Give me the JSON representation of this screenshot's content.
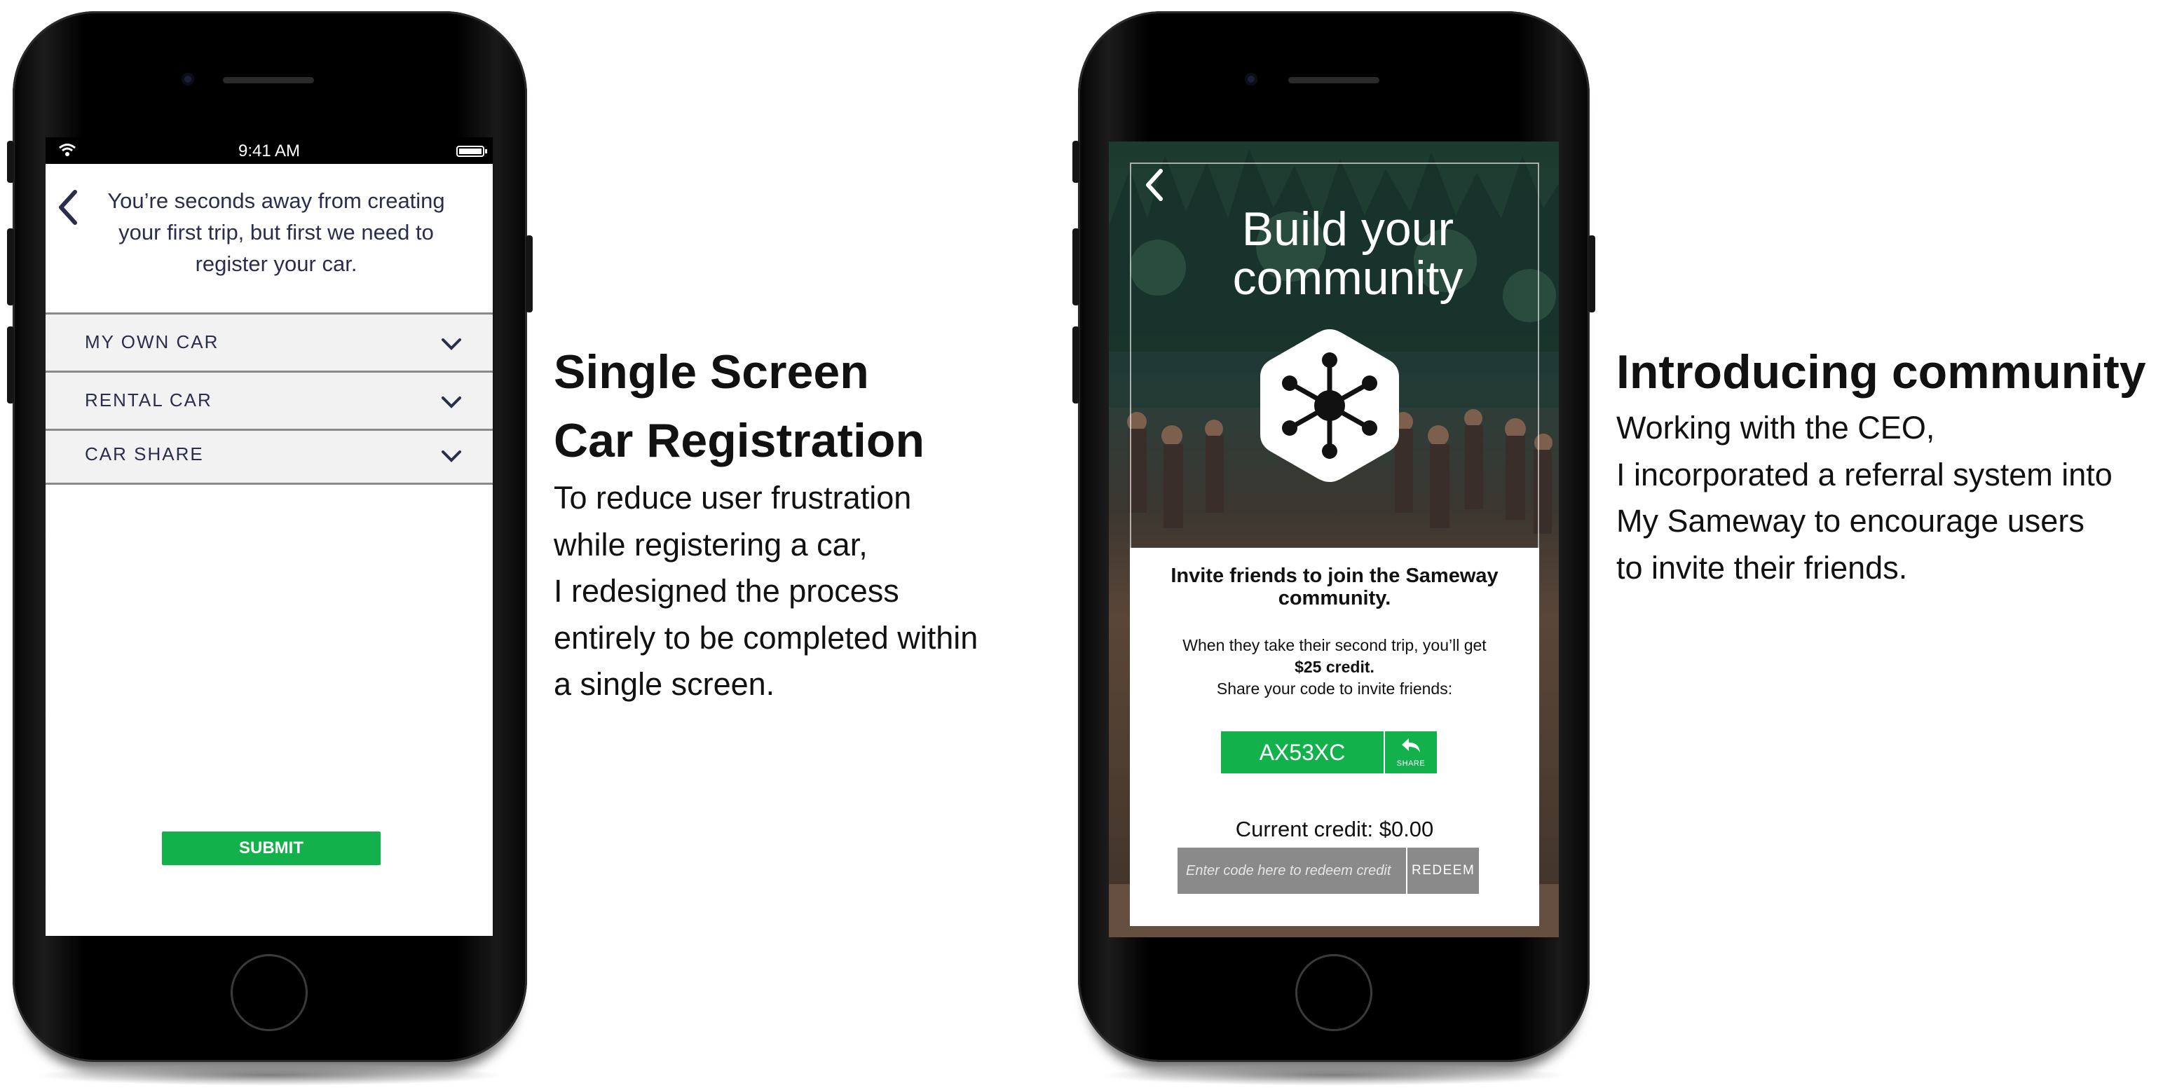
{
  "phone1": {
    "status_time": "9:41 AM",
    "header": "You’re seconds away from creating your first trip, but first we need to register your car.",
    "options": [
      {
        "label": "MY OWN CAR"
      },
      {
        "label": "RENTAL CAR"
      },
      {
        "label": "CAR SHARE"
      }
    ],
    "submit_label": "SUBMIT"
  },
  "caption1": {
    "title_lines": [
      "Single Screen",
      "Car Registration"
    ],
    "body_lines": [
      "To reduce user frustration",
      "while registering a car,",
      "I redesigned the process",
      "entirely to be completed within",
      "a single screen."
    ]
  },
  "phone2": {
    "title_lines": [
      "Build your",
      "community"
    ],
    "invite_text": "Invite friends to join the Sameway community.",
    "info_line1": "When they take their second trip, you’ll get",
    "info_credit": "$25 credit.",
    "info_line3": "Share your code to invite friends:",
    "code": "AX53XC",
    "share_label": "SHARE",
    "current_credit": "Current credit: $0.00",
    "redeem_placeholder": "Enter code here to redeem credit",
    "redeem_label": "REDEEM"
  },
  "caption2": {
    "title": "Introducing community",
    "body_lines": [
      "Working with the CEO,",
      "I incorporated a referral system into",
      "My Sameway to encourage users",
      "to invite their friends."
    ]
  },
  "colors": {
    "brand_green": "#13b14b",
    "header_text": "#2b2d4e",
    "grey_button": "#8a8a8a"
  },
  "icons": [
    "wifi-icon",
    "battery-icon",
    "back-chevron-icon",
    "chevron-down-icon",
    "hex-network-logo-icon",
    "share-arrow-icon"
  ]
}
